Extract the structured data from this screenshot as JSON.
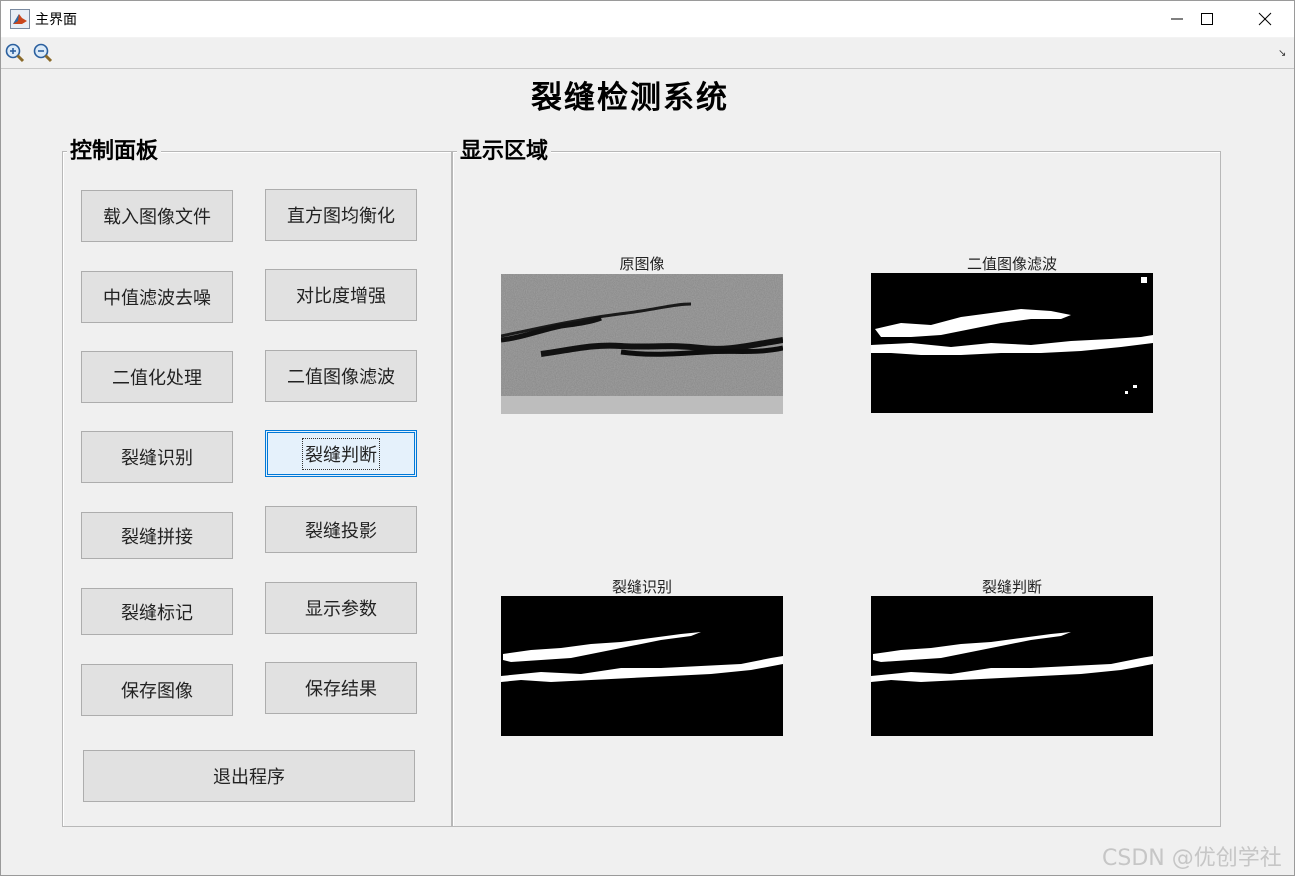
{
  "window": {
    "title": "主界面",
    "icon": "matlab-icon"
  },
  "toolbar": {
    "zoom_in": "zoom-in-icon",
    "zoom_out": "zoom-out-icon",
    "arrow": "↘"
  },
  "main_title": "裂缝检测系统",
  "control_panel": {
    "title": "控制面板",
    "buttons": {
      "load": "载入图像文件",
      "hist": "直方图均衡化",
      "median": "中值滤波去噪",
      "contrast": "对比度增强",
      "binarize": "二值化处理",
      "binfilter": "二值图像滤波",
      "recognize": "裂缝识别",
      "judge": "裂缝判断",
      "stitch": "裂缝拼接",
      "project": "裂缝投影",
      "mark": "裂缝标记",
      "params": "显示参数",
      "save_image": "保存图像",
      "save_result": "保存结果",
      "exit": "退出程序"
    }
  },
  "display_panel": {
    "title": "显示区域",
    "images": {
      "original": "原图像",
      "binary_filter": "二值图像滤波",
      "recognition": "裂缝识别",
      "judgement": "裂缝判断"
    }
  },
  "watermark": "CSDN @优创学社",
  "colors": {
    "focus": "#0078d7",
    "panel_bg": "#f0f0f0",
    "button_bg": "#e1e1e1"
  }
}
